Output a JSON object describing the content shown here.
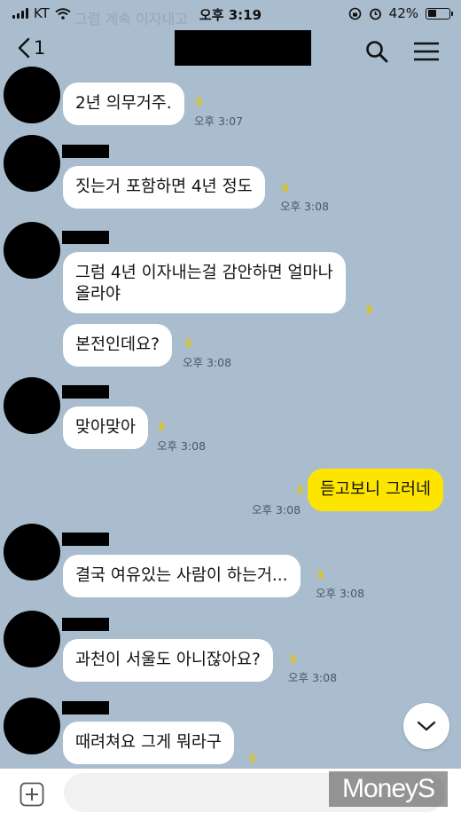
{
  "status_bar": {
    "carrier": "KT",
    "time": "오후 3:19",
    "battery": "42%",
    "ghost_text": "그럼 계속 이자내고"
  },
  "header": {
    "back_label": "1"
  },
  "messages": [
    {
      "text": "2년 의무거주.",
      "unread": "3",
      "time": "오후 3:07"
    },
    {
      "text": "짓는거 포함하면 4년 정도",
      "unread": "3",
      "time": "오후 3:08"
    },
    {
      "line1": "그럼 4년 이자내는걸 감안하면 얼마나",
      "line2": "올라야",
      "unread": "3"
    },
    {
      "text": "본전인데요?",
      "unread": "3",
      "time": "오후 3:08"
    },
    {
      "text": "맞아맞아",
      "unread": "3",
      "time": "오후 3:08"
    },
    {
      "text": "듣고보니 그러네",
      "unread": "3",
      "time": "오후 3:08"
    },
    {
      "text": "결국 여유있는 사람이 하는거...",
      "unread": "3",
      "time": "오후 3:08"
    },
    {
      "text": "과천이 서울도 아니잖아요?",
      "unread": "3",
      "time": "오후 3:08"
    },
    {
      "text": "때려쳐요 그게 뭐라구",
      "unread": "3"
    }
  ],
  "watermark": "MoneyS",
  "colors": {
    "chat_bg": "#a9bdce",
    "my_bubble": "#fee500",
    "unread": "#e4c300"
  },
  "icons": [
    "back-arrow-icon",
    "search-icon",
    "menu-icon",
    "chevron-down-icon",
    "plus-icon",
    "wifi-icon",
    "alarm-icon"
  ]
}
